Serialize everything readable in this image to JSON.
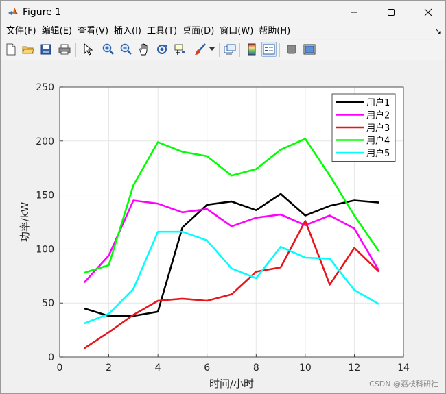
{
  "window": {
    "title": "Figure 1"
  },
  "menu": {
    "items": [
      "文件(F)",
      "编辑(E)",
      "查看(V)",
      "插入(I)",
      "工具(T)",
      "桌面(D)",
      "窗口(W)",
      "帮助(H)"
    ]
  },
  "toolbar": {
    "icons": [
      "new-file-icon",
      "open-folder-icon",
      "save-icon",
      "print-icon",
      "pointer-icon",
      "zoom-in-icon",
      "zoom-out-icon",
      "pan-hand-icon",
      "rotate-3d-icon",
      "data-cursor-icon",
      "brush-icon",
      "link-plot-icon",
      "colorbar-icon",
      "legend-icon",
      "hide-plot-tools-icon",
      "show-plot-tools-icon"
    ]
  },
  "chart_data": {
    "type": "line",
    "xlabel": "时间/小时",
    "ylabel": "功率/kW",
    "xlim": [
      0,
      14
    ],
    "ylim": [
      0,
      250
    ],
    "xticks": [
      0,
      2,
      4,
      6,
      8,
      10,
      12,
      14
    ],
    "yticks": [
      0,
      50,
      100,
      150,
      200,
      250
    ],
    "grid": true,
    "legend_position": "top-right",
    "x": [
      1,
      2,
      3,
      4,
      5,
      6,
      7,
      8,
      9,
      10,
      11,
      12,
      13
    ],
    "series": [
      {
        "name": "用户1",
        "color": "#000000",
        "values": [
          45,
          38,
          38,
          42,
          120,
          141,
          144,
          136,
          151,
          131,
          140,
          145,
          143
        ]
      },
      {
        "name": "用户2",
        "color": "#ff00ff",
        "values": [
          69,
          94,
          145,
          142,
          134,
          137,
          121,
          129,
          132,
          122,
          131,
          119,
          80
        ]
      },
      {
        "name": "用户3",
        "color": "#e8151b",
        "values": [
          8,
          23,
          39,
          52,
          54,
          52,
          58,
          79,
          83,
          126,
          67,
          101,
          79
        ]
      },
      {
        "name": "用户4",
        "color": "#00ff00",
        "values": [
          78,
          85,
          159,
          199,
          190,
          186,
          168,
          174,
          192,
          202,
          168,
          131,
          98
        ]
      },
      {
        "name": "用户5",
        "color": "#00ffff",
        "values": [
          31,
          40,
          63,
          116,
          116,
          108,
          82,
          73,
          102,
          92,
          91,
          62,
          49
        ]
      }
    ]
  },
  "watermark": "CSDN @荔枝科研社"
}
